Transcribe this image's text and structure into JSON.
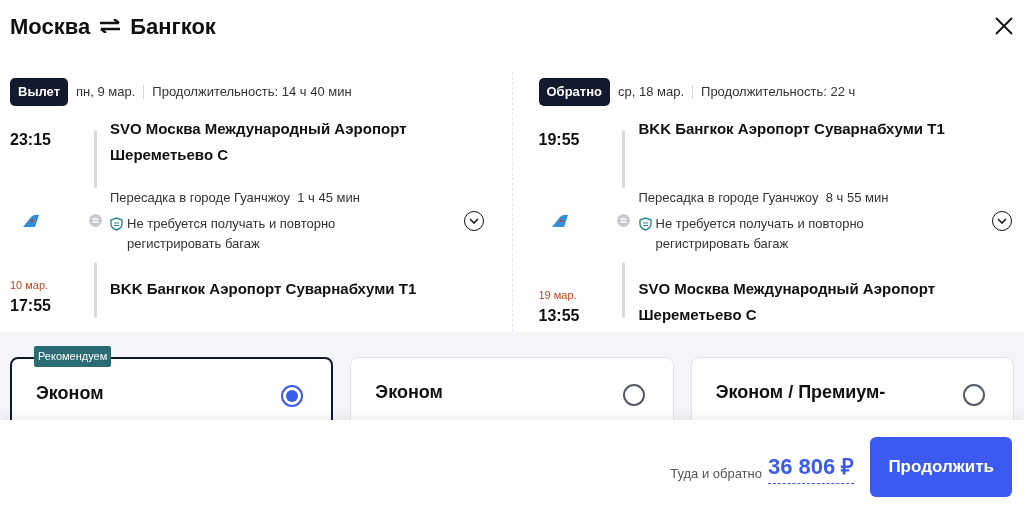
{
  "title": {
    "from": "Москва",
    "to": "Бангкок"
  },
  "segments": [
    {
      "badge": "Вылет",
      "date": "пн, 9 мар.",
      "duration": "Продолжительность: 14 ч 40 мин",
      "depart_time": "23:15",
      "depart_airport": "SVO Москва Международный Аэропорт Шереметьево C",
      "transfer": "Пересадка в городе Гуанчжоу  1 ч 45 мин",
      "baggage_note": "Не требуется получать и повторно регистрировать багаж",
      "arrive_date": "10 мар.",
      "arrive_time": "17:55",
      "arrive_airport": "BKK Бангкок Аэропорт Суварнабхуми T1"
    },
    {
      "badge": "Обратно",
      "date": "ср, 18 мар.",
      "duration": "Продолжительность: 22 ч",
      "depart_time": "19:55",
      "depart_airport": "BKK Бангкок Аэропорт Суварнабхуми T1",
      "transfer": "Пересадка в городе Гуанчжоу  8 ч 55 мин",
      "baggage_note": "Не требуется получать и повторно регистрировать багаж",
      "arrive_date": "19 мар.",
      "arrive_time": "13:55",
      "arrive_airport": "SVO Москва Международный Аэропорт Шереметьево C"
    }
  ],
  "fares": [
    {
      "name": "Эконом",
      "tag": "Рекомендуем",
      "selected": true
    },
    {
      "name": "Эконом",
      "selected": false
    },
    {
      "name": "Эконом / Премиум-",
      "selected": false
    }
  ],
  "footer": {
    "price_label": "Туда и обратно",
    "price": "36 806 ₽",
    "button": "Продолжить"
  }
}
